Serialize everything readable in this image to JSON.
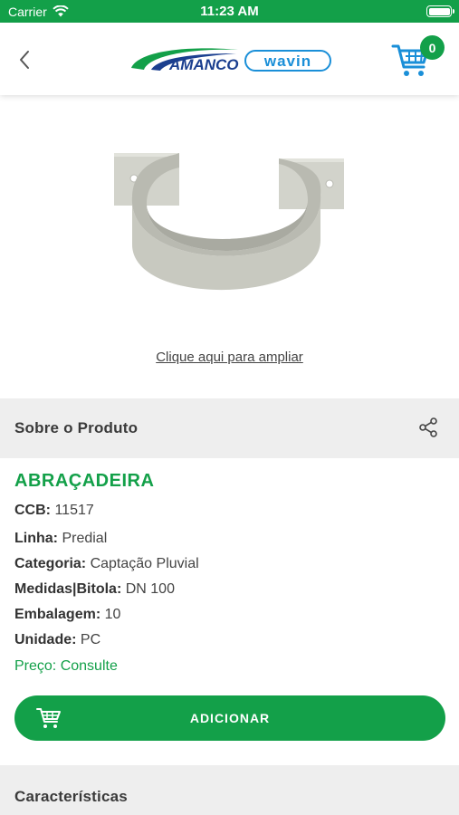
{
  "status_bar": {
    "carrier": "Carrier",
    "time": "11:23 AM"
  },
  "nav": {
    "cart_count": "0",
    "brand_left": "AMANCO",
    "brand_right": "wavin"
  },
  "product_image": {
    "zoom_label": "Clique aqui para ampliar"
  },
  "about_section": {
    "title": "Sobre o Produto"
  },
  "product": {
    "name": "ABRAÇADEIRA",
    "specs": [
      {
        "label": "CCB:",
        "value": "11517"
      },
      {
        "label": "Linha:",
        "value": "Predial"
      },
      {
        "label": "Categoria:",
        "value": "Captação Pluvial"
      },
      {
        "label": "Medidas|Bitola:",
        "value": "DN 100"
      },
      {
        "label": "Embalagem:",
        "value": "10"
      },
      {
        "label": "Unidade:",
        "value": "PC"
      }
    ],
    "price_label": "Preço:",
    "price_value": "Consulte"
  },
  "add_button": {
    "label": "ADICIONAR"
  },
  "features_section": {
    "title": "Características"
  },
  "colors": {
    "brand_green": "#13a049",
    "section_bg": "#eeeeee",
    "wavin_blue": "#1a8fd8",
    "amanco_blue": "#1b3f8f"
  }
}
